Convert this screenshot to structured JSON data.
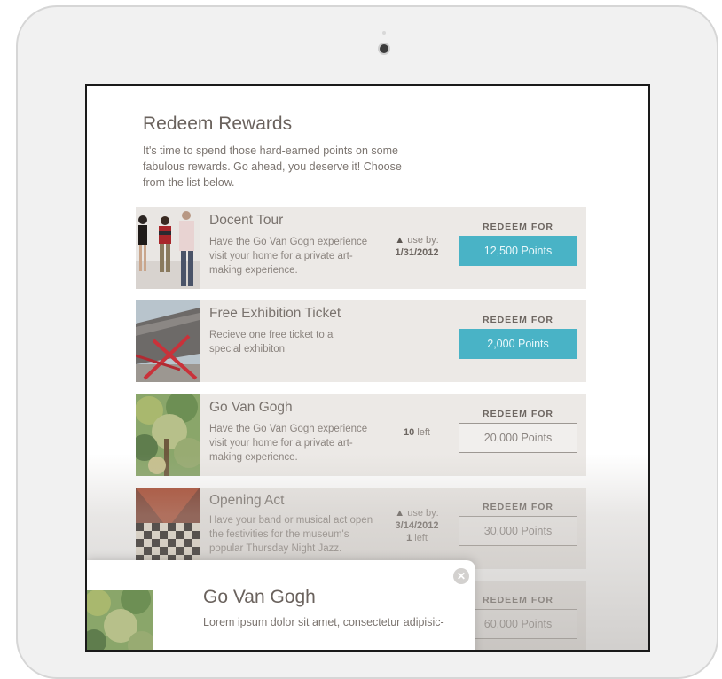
{
  "page": {
    "title": "Redeem Rewards",
    "intro": "It's time to spend those hard-earned points on some fabulous rewards. Go ahead, you deserve it! Choose from the list below."
  },
  "rewards": [
    {
      "title": "Docent Tour",
      "description": "Have the Go Van Gogh experience visit your home for a private art-making experience.",
      "use_by_label": "use by:",
      "use_by_date": "1/31/2012",
      "redeem_label": "REDEEM FOR",
      "points": "12,500 Points",
      "image": "photo of docent with visitors"
    },
    {
      "title": "Free Exhibition Ticket",
      "description": "Recieve one free ticket to a special exhibiton",
      "redeem_label": "REDEEM FOR",
      "points": "2,000 Points",
      "image": "photo of museum building with red sculpture"
    },
    {
      "title": "Go Van Gogh",
      "description": "Have the Go Van Gogh experience visit your home for a private art-making experience.",
      "left_count": "10",
      "left_label": "left",
      "redeem_label": "REDEEM FOR",
      "points": "20,000 Points",
      "image": "impressionist tree painting"
    },
    {
      "title": "Opening Act",
      "description": "Have your band or musical act open the festivities for the museum's popular Thursday Night Jazz.",
      "use_by_label": "use by:",
      "use_by_date": "3/14/2012",
      "left_count": "1",
      "left_label": "left",
      "redeem_label": "REDEEM FOR",
      "points": "30,000 Points",
      "image": "checkered textile artwork"
    },
    {
      "redeem_label": "REDEEM FOR",
      "points": "60,000 Points"
    }
  ],
  "modal": {
    "title": "Go Van Gogh",
    "text": "Lorem ipsum dolor sit amet, consectetur adipisic-",
    "close_icon": "close-icon"
  },
  "colors": {
    "accent": "#49b3c6",
    "row_bg": "#ece9e6",
    "text": "#6f6a66"
  }
}
